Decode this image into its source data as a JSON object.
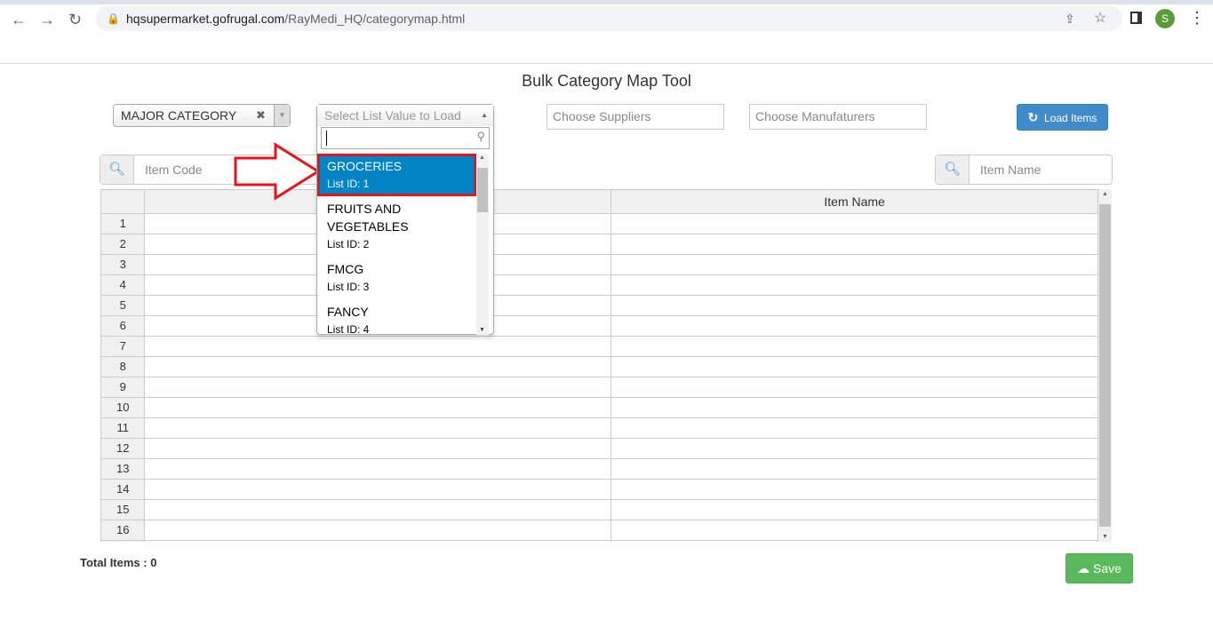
{
  "browser": {
    "url_host": "hqsupermarket.gofrugal.com",
    "url_path": "/RayMedi_HQ/categorymap.html",
    "profile_initial": "S"
  },
  "page": {
    "title": "Bulk Category Map Tool"
  },
  "filters": {
    "category_type": "MAJOR CATEGORY",
    "list_value_placeholder": "Select List Value to Load",
    "suppliers_placeholder": "Choose Suppliers",
    "manufacturers_placeholder": "Choose Manufaturers",
    "load_label": "Load Items"
  },
  "search": {
    "item_code_placeholder": "Item Code",
    "item_name_placeholder": "Item Name"
  },
  "dropdown": {
    "options": [
      {
        "name": "GROCERIES",
        "id": "List ID: 1"
      },
      {
        "name": "FRUITS AND VEGETABLES",
        "id": "List ID: 2"
      },
      {
        "name": "FMCG",
        "id": "List ID: 3"
      },
      {
        "name": "FANCY",
        "id": "List ID: 4"
      }
    ],
    "highlighted": 0
  },
  "table": {
    "columns": [
      "",
      "",
      "Item Name"
    ],
    "rows": [
      "1",
      "2",
      "3",
      "4",
      "5",
      "6",
      "7",
      "8",
      "9",
      "10",
      "11",
      "12",
      "13",
      "14",
      "15",
      "16",
      ""
    ]
  },
  "footer": {
    "total_label": "Total Items : 0",
    "save_label": "Save"
  },
  "colors": {
    "highlight": "#0084c4",
    "annotation": "#e8141c",
    "save": "#5cb85c",
    "load": "#428bca"
  }
}
